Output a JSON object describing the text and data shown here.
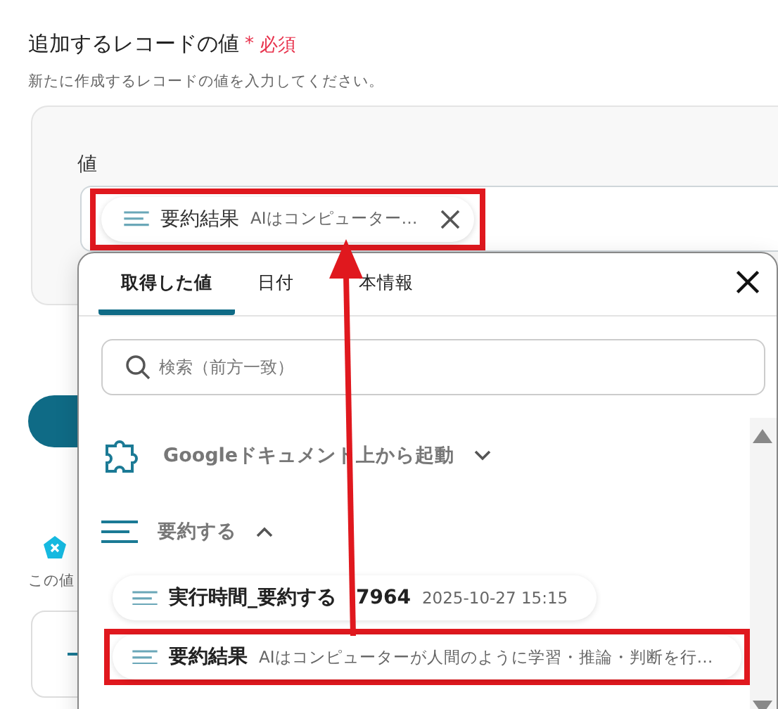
{
  "field": {
    "label": "追加するレコードの値",
    "required_mark": "*",
    "required": "必須",
    "help": "新たに作成するレコードの値を入力してください。",
    "value_label": "値",
    "chip": {
      "name": "要約結果",
      "preview": "AIはコンピューター…",
      "highlighted": true
    }
  },
  "background": {
    "section_help": "この値"
  },
  "popup": {
    "tabs": [
      {
        "label": "取得した値",
        "selected": true,
        "lead_covered": false
      },
      {
        "label": "日付",
        "selected": false,
        "lead_covered": false
      },
      {
        "label": "本情報",
        "selected": false,
        "lead_covered": true
      }
    ],
    "search": {
      "placeholder": "検索（前方一致）"
    },
    "groups": [
      {
        "kind": "puzzle",
        "title": "Googleドキュメント上から起動",
        "expanded": false
      },
      {
        "kind": "lines",
        "title": "要約する",
        "expanded": true,
        "items": [
          {
            "name": "実行時間_要約する",
            "name_tail": "7964",
            "value": "2025-10-27 15:15",
            "highlighted": false
          },
          {
            "name": "要約結果",
            "value": "AIはコンピューターが人間のように学習・推論・判断を行…",
            "highlighted": true
          }
        ]
      }
    ]
  }
}
